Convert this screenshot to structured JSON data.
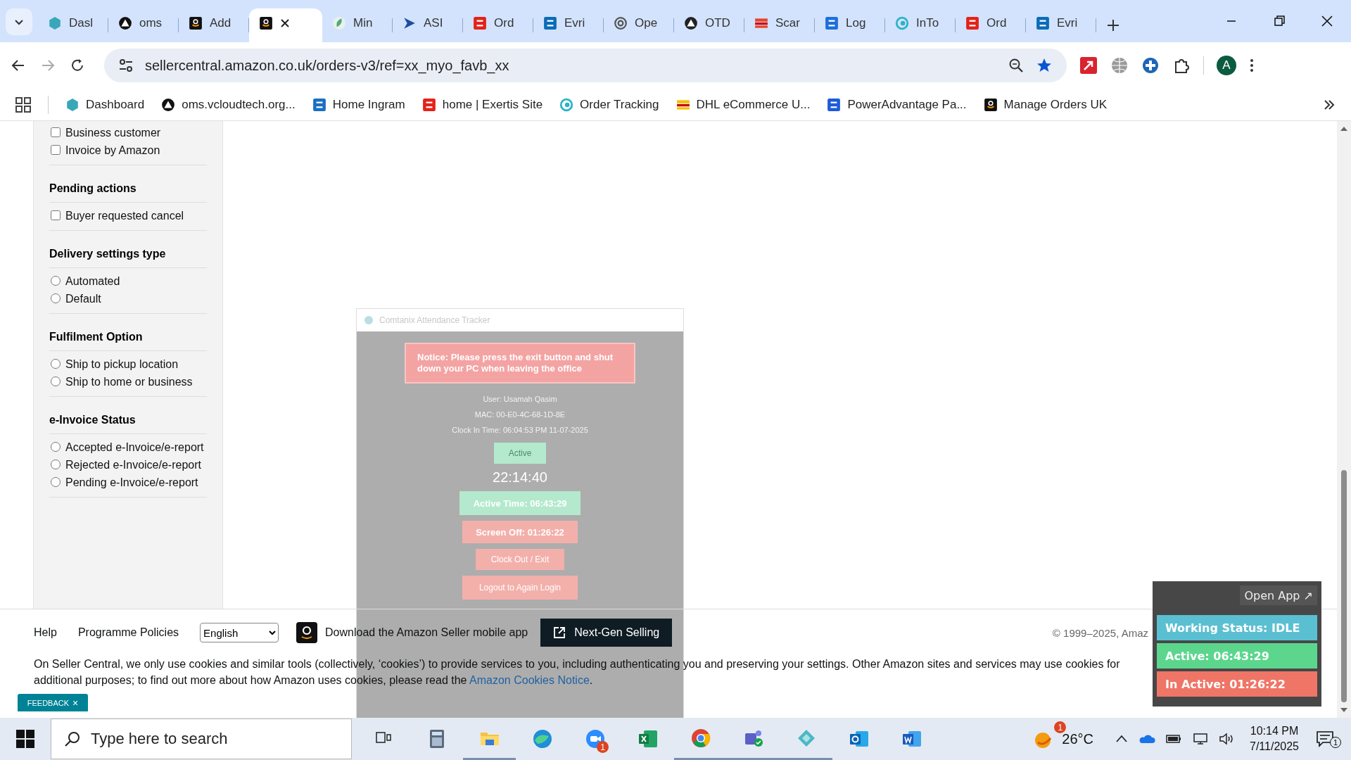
{
  "browser": {
    "tabs": [
      {
        "label": "Dasl",
        "selected": false
      },
      {
        "label": "oms",
        "selected": false
      },
      {
        "label": "Add",
        "selected": false
      },
      {
        "selected": true
      },
      {
        "label": "Min",
        "selected": false
      },
      {
        "label": "ASI",
        "selected": false
      },
      {
        "label": "Ord",
        "selected": false
      },
      {
        "label": "Evri",
        "selected": false
      },
      {
        "label": "Ope",
        "selected": false
      },
      {
        "label": "OTD",
        "selected": false
      },
      {
        "label": "Scar",
        "selected": false
      },
      {
        "label": "Log",
        "selected": false
      },
      {
        "label": "InTo",
        "selected": false
      },
      {
        "label": "Ord",
        "selected": false
      },
      {
        "label": "Evri",
        "selected": false
      }
    ],
    "address_bar": {
      "url": "sellercentral.amazon.co.uk/orders-v3/ref=xx_myo_favb_xx"
    },
    "profile_initial": "A",
    "bookmarks": [
      "Dashboard",
      "oms.vcloudtech.org...",
      "Home Ingram",
      "home | Exertis Site",
      "Order Tracking",
      "DHL eCommerce U...",
      "PowerAdvantage Pa...",
      "Manage Orders UK"
    ]
  },
  "sidebar": {
    "sections": [
      {
        "options": [
          {
            "label": "Business customer",
            "kind": "checkbox",
            "checked": false
          },
          {
            "label": "Invoice by Amazon",
            "kind": "checkbox",
            "checked": false
          }
        ]
      },
      {
        "heading": "Pending actions",
        "options": [
          {
            "label": "Buyer requested cancel",
            "kind": "checkbox",
            "checked": false
          }
        ]
      },
      {
        "heading": "Delivery settings type",
        "options": [
          {
            "label": "Automated",
            "kind": "radio",
            "checked": false
          },
          {
            "label": "Default",
            "kind": "radio",
            "checked": false
          }
        ]
      },
      {
        "heading": "Fulfilment Option",
        "options": [
          {
            "label": "Ship to pickup location",
            "kind": "radio",
            "checked": false
          },
          {
            "label": "Ship to home or business",
            "kind": "radio",
            "checked": false
          }
        ]
      },
      {
        "heading": "e-Invoice Status",
        "options": [
          {
            "label": "Accepted e-Invoice/e-report",
            "kind": "radio",
            "checked": false
          },
          {
            "label": "Rejected e-Invoice/e-report",
            "kind": "radio",
            "checked": false
          },
          {
            "label": "Pending e-Invoice/e-report",
            "kind": "radio",
            "checked": false
          }
        ]
      }
    ]
  },
  "footer": {
    "links": [
      "Help",
      "Programme Policies"
    ],
    "language": "English",
    "app_promo": "Download the Amazon Seller mobile app",
    "next_gen_button": "Next-Gen Selling",
    "copyright": "© 1999–2025, Amaz",
    "cookie_notice": {
      "text": "On Seller Central, we only use cookies and similar tools (collectively, ‘cookies’) to provide services to you, including authenticating you and preserving your settings. Other Amazon sites and services may use cookies for additional purposes; to find out more about how Amazon uses cookies, please read the ",
      "link": "Amazon Cookies Notice",
      "after": "."
    },
    "feedback": {
      "label": "FEEDBACK",
      "close": "×"
    }
  },
  "tracker": {
    "title": "Comtanix Attendance Tracker",
    "notice": "Notice: Please press the exit button and shut down your PC when leaving the office",
    "user": "User: Usamah Qasim",
    "mac": "MAC: 00-E0-4C-68-1D-8E",
    "clock_in": "Clock In Time: 06:04:53 PM 11-07-2025",
    "status_button": "Active",
    "clock": "22:14:40",
    "active_time": "Active Time: 06:43:29",
    "screen_off": "Screen Off: 01:26:22",
    "clock_out_button": "Clock Out / Exit",
    "logout_button": "Logout to Again Login"
  },
  "status_widget": {
    "open_app": "Open App ↗",
    "statuses": [
      {
        "text": "Working Status: IDLE",
        "color": "#5bbfd2"
      },
      {
        "text": "Active: 06:43:29",
        "color": "#5cd68d"
      },
      {
        "text": "In Active: 01:26:22",
        "color": "#ef7566"
      }
    ]
  },
  "taskbar": {
    "search_placeholder": "Type here to search",
    "zoom_badge": "1",
    "weather_badge": "1",
    "temperature": "26°C",
    "time": "10:14 PM",
    "date": "7/11/2025",
    "notifications": "1"
  }
}
